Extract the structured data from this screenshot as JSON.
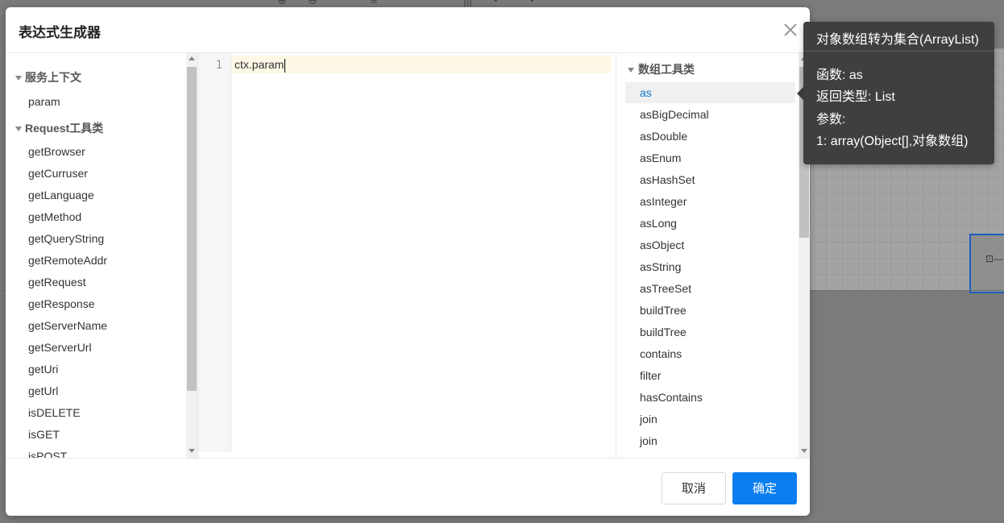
{
  "dialog": {
    "title": "表达式生成器",
    "cancel_label": "取消",
    "ok_label": "确定"
  },
  "left_tree": {
    "group1_label": "服务上下文",
    "group1_items": [
      "param"
    ],
    "group2_label": "Request工具类",
    "group2_items": [
      "getBrowser",
      "getCurruser",
      "getLanguage",
      "getMethod",
      "getQueryString",
      "getRemoteAddr",
      "getRequest",
      "getResponse",
      "getServerName",
      "getServerUrl",
      "getUri",
      "getUrl",
      "isDELETE",
      "isGET",
      "isPOST"
    ]
  },
  "editor": {
    "line_number": "1",
    "code": "ctx.param"
  },
  "right_tree": {
    "group_label": "数组工具类",
    "selected_index": 0,
    "items": [
      "as",
      "asBigDecimal",
      "asDouble",
      "asEnum",
      "asHashSet",
      "asInteger",
      "asLong",
      "asObject",
      "asString",
      "asTreeSet",
      "buildTree",
      "buildTree",
      "contains",
      "filter",
      "hasContains",
      "join",
      "join"
    ]
  },
  "tooltip": {
    "title": "对象数组转为集合(ArrayList)",
    "function": "函数: as",
    "return_type": "返回类型: List",
    "params_label": "参数:",
    "param1": "1: array(Object[],对象数组)"
  },
  "colors": {
    "primary": "#0a7ef0",
    "selected_text": "#1677c7",
    "tooltip_bg": "#3f3f3f"
  }
}
